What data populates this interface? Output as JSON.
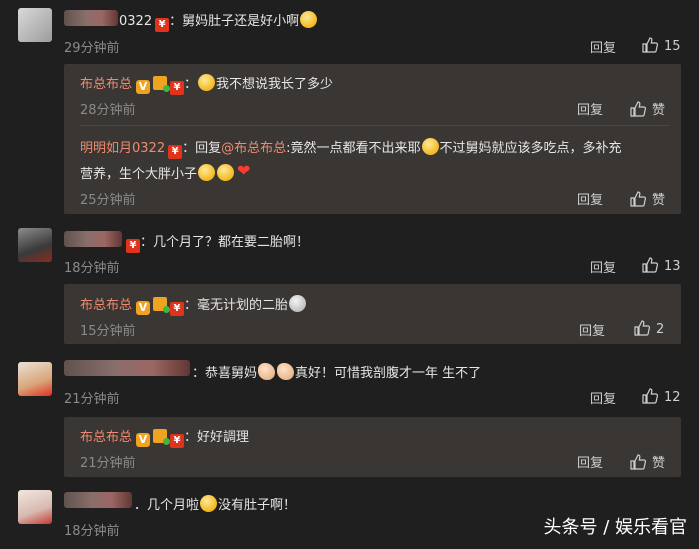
{
  "comments": [
    {
      "name_tail": "0322",
      "text": "：舅妈肚子还是好小啊",
      "time": "29分钟前",
      "reply": "回复",
      "likes": "15",
      "subs": [
        {
          "user": "布总布总",
          "text": "：",
          "text2": "我不想说我长了多少",
          "time": "28分钟前",
          "reply": "回复",
          "like": "赞"
        },
        {
          "user": "明明如月0322",
          "text": "：回复",
          "mention": "@布总布总",
          "text2": ":竟然一点都看不出来耶",
          "text3": "不过舅妈就应该多吃点，多补充",
          "text4": "营养，生个大胖小子",
          "time": "25分钟前",
          "reply": "回复",
          "like": "赞"
        }
      ]
    },
    {
      "text": "：几个月了？都在要二胎啊！",
      "time": "18分钟前",
      "reply": "回复",
      "likes": "13",
      "subs": [
        {
          "user": "布总布总",
          "text": "：毫无计划的二胎",
          "time": "15分钟前",
          "reply": "回复",
          "likes": "2"
        }
      ]
    },
    {
      "text": "：恭喜舅妈",
      "text2": "真好！可惜我剖腹才一年 生不了",
      "time": "21分钟前",
      "reply": "回复",
      "likes": "12",
      "subs": [
        {
          "user": "布总布总",
          "text": "：好好調理",
          "time": "21分钟前",
          "reply": "回复",
          "like": "赞"
        }
      ]
    },
    {
      "text": "．几个月啦",
      "text2": "没有肚子啊！",
      "time": "18分钟前"
    }
  ],
  "watermark": "头条号 / 娱乐看官"
}
